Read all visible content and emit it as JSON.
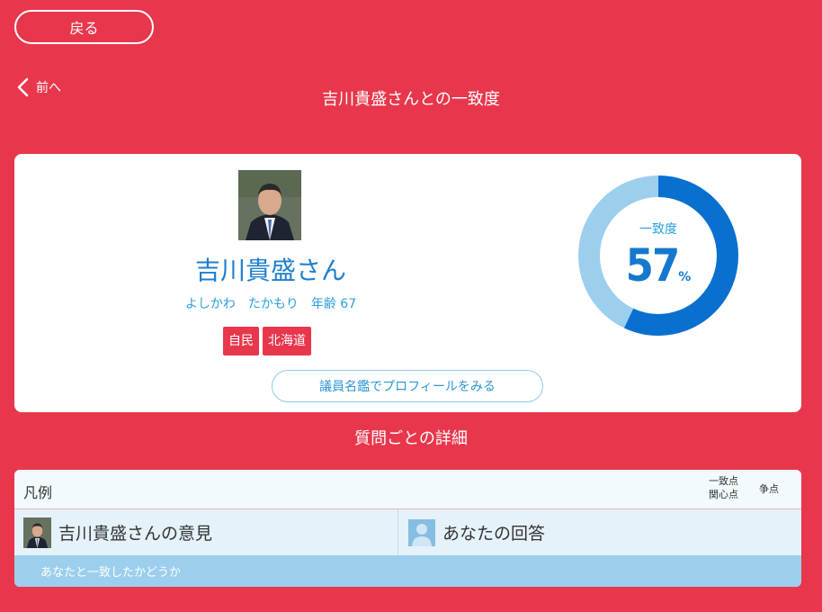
{
  "header": {
    "back_label": "戻る",
    "prev_label": "前へ",
    "title": "吉川貴盛さんとの一致度"
  },
  "profile": {
    "name": "吉川貴盛さん",
    "reading": "よしかわ　たかもり　年齢 67",
    "tags": [
      "自民",
      "北海道"
    ],
    "profile_button": "議員名鑑でプロフィールをみる"
  },
  "match": {
    "label": "一致度",
    "value": 57,
    "value_text": "57",
    "unit": "%",
    "colors": {
      "fill": "#0a70cf",
      "track": "#9ccfee"
    }
  },
  "details": {
    "section_title": "質問ごとの詳細"
  },
  "legend": {
    "title": "凡例",
    "key_match": "一致点",
    "key_concern": "関心点",
    "key_dispute": "争点",
    "politician_opinion": "吉川貴盛さんの意見",
    "your_answer": "あなたの回答",
    "agree_note": "あなたと一致したかどうか"
  }
}
